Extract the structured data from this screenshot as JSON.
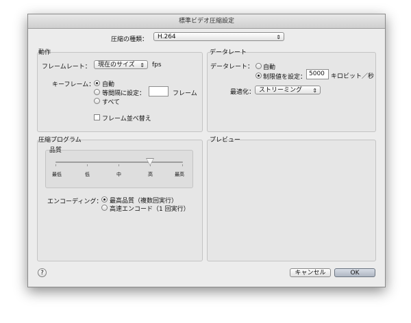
{
  "window": {
    "title": "標準ビデオ圧縮設定"
  },
  "compression": {
    "label": "圧縮の種類：",
    "value": "H.264"
  },
  "motion": {
    "title": "動作",
    "framerate_label": "フレームレート：",
    "framerate_value": "現在のサイズ",
    "framerate_unit": "fps",
    "keyframe_label": "キーフレーム：",
    "keyframe_options": [
      "自動",
      "等間隔に設定：",
      "すべて"
    ],
    "keyframe_selected": "自動",
    "keyframe_interval_value": "",
    "keyframe_interval_unit": "フレーム",
    "frame_reorder_label": "フレーム並べ替え",
    "frame_reorder_checked": false
  },
  "datarate": {
    "title": "データレート",
    "label": "データレート：",
    "options": [
      "自動",
      "制限値を設定："
    ],
    "selected": "制限値を設定：",
    "limit_value": "5000",
    "unit": "キロビット／秒",
    "optimize_label": "最適化：",
    "optimize_value": "ストリーミング"
  },
  "compressor": {
    "title": "圧縮プログラム",
    "quality_label": "品質",
    "quality_ticks": [
      "最低",
      "低",
      "中",
      "高",
      "最高"
    ],
    "quality_value": "高",
    "encoding_label": "エンコーディング：",
    "encoding_options": [
      "最高品質（複数回実行）",
      "高速エンコード（1 回実行）"
    ],
    "encoding_selected": "最高品質（複数回実行）"
  },
  "preview": {
    "title": "プレビュー"
  },
  "buttons": {
    "help": "?",
    "cancel": "キャンセル",
    "ok": "OK"
  }
}
